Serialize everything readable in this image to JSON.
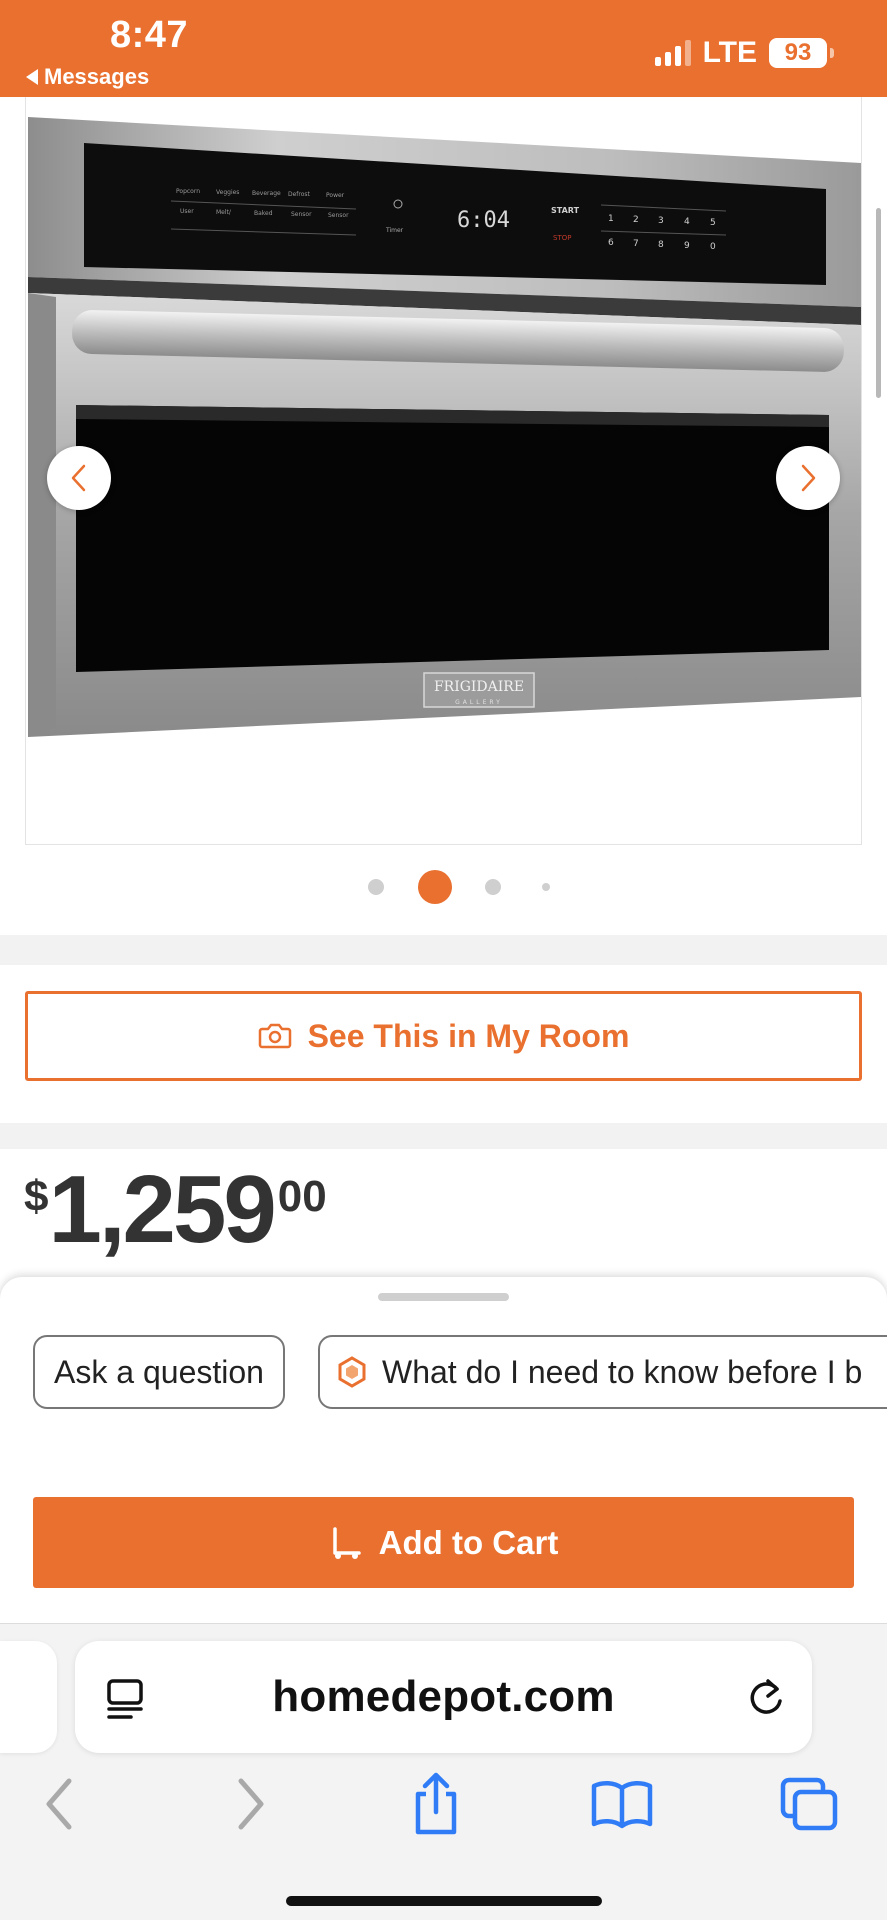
{
  "status_bar": {
    "time": "8:47",
    "back_label": "Messages",
    "network": "LTE",
    "battery": "93"
  },
  "gallery": {
    "image_alt": "Frigidaire Gallery built-in microwave oven, stainless steel",
    "brand_badge": "FRIGIDAIRE",
    "brand_sub": "GALLERY",
    "display_time": "6:04",
    "active_index": 1,
    "dot_count": 4
  },
  "room_button": {
    "label": "See This in My Room"
  },
  "price": {
    "currency": "$",
    "dollars": "1,259",
    "cents": "00"
  },
  "sheet": {
    "chips": [
      {
        "label": "Ask a question"
      },
      {
        "label": "What do I need to know before I b"
      }
    ]
  },
  "cart": {
    "label": "Add to Cart"
  },
  "browser": {
    "url": "homedepot.com"
  },
  "colors": {
    "brand_orange": "#e9702f",
    "ios_blue": "#2f7cf6"
  }
}
